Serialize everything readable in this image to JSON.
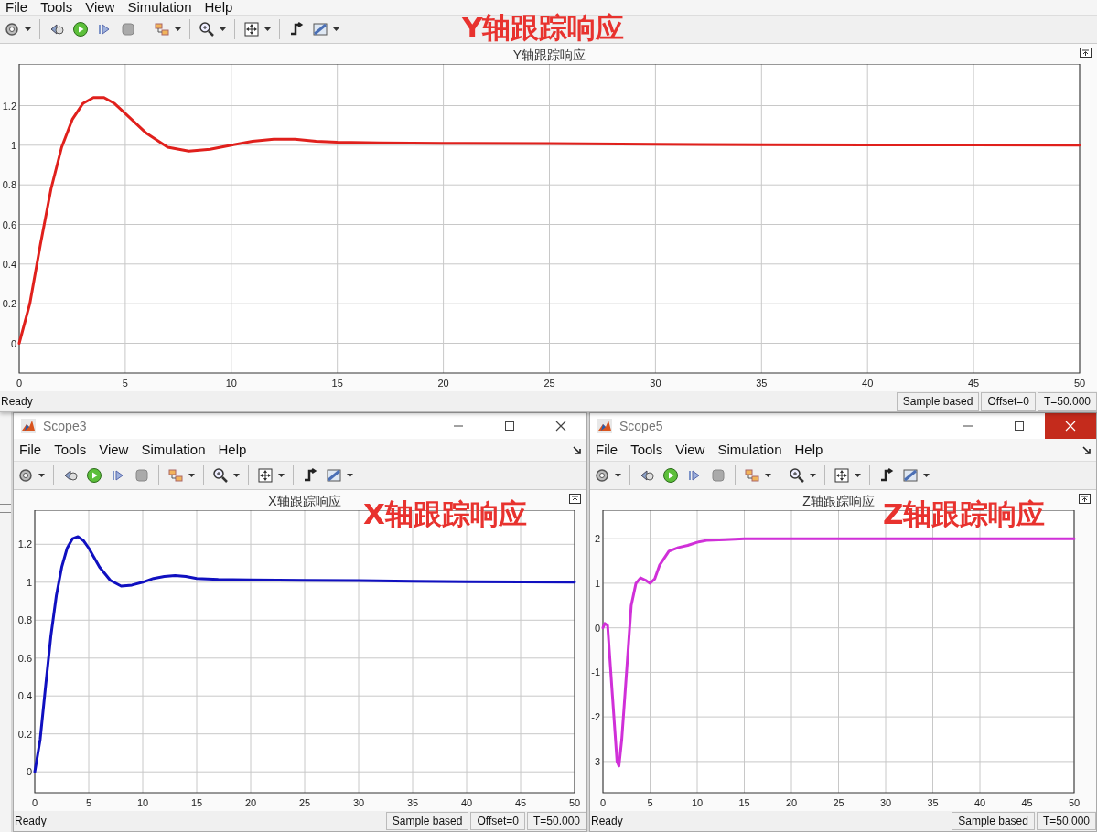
{
  "windows": [
    {
      "kind": "main",
      "menu": [
        "File",
        "Tools",
        "View",
        "Simulation",
        "Help"
      ],
      "annotation": "Y轴跟踪响应",
      "chart_data": {
        "type": "line",
        "title": "Y轴跟踪响应",
        "grid": true,
        "x": [
          0,
          0.5,
          1,
          1.5,
          2,
          2.5,
          3,
          3.5,
          4,
          4.5,
          5,
          6,
          7,
          8,
          9,
          10,
          11,
          12,
          13,
          14,
          15,
          17,
          20,
          25,
          30,
          35,
          40,
          45,
          50
        ],
        "xlim": [
          0,
          50
        ],
        "ylim": [
          -0.15,
          1.41
        ],
        "xticks": [
          0,
          5,
          10,
          15,
          20,
          25,
          30,
          35,
          40,
          45,
          50
        ],
        "yticks": [
          0,
          0.2,
          0.4,
          0.6,
          0.8,
          1,
          1.2
        ],
        "series": [
          {
            "color": "#e0201c",
            "values": [
              0,
              0.2,
              0.5,
              0.78,
              0.99,
              1.13,
              1.21,
              1.24,
              1.24,
              1.21,
              1.16,
              1.06,
              0.99,
              0.97,
              0.98,
              1.0,
              1.02,
              1.03,
              1.03,
              1.02,
              1.015,
              1.012,
              1.01,
              1.008,
              1.005,
              1.003,
              1.002,
              1.001,
              1.0
            ]
          }
        ]
      },
      "status_bar": {
        "message": "Ready",
        "fields": [
          "Sample based",
          "Offset=0",
          "T=50.000"
        ]
      }
    },
    {
      "kind": "scope",
      "title": "Scope3",
      "close_hover": false,
      "menu": [
        "File",
        "Tools",
        "View",
        "Simulation",
        "Help"
      ],
      "annotation": "X轴跟踪响应",
      "chart_data": {
        "type": "line",
        "title": "X轴跟踪响应",
        "grid": true,
        "x": [
          0,
          0.5,
          1,
          1.5,
          2,
          2.5,
          3,
          3.5,
          4,
          4.5,
          5,
          6,
          7,
          8,
          9,
          10,
          11,
          12,
          13,
          14,
          15,
          17,
          20,
          25,
          30,
          35,
          40,
          45,
          50
        ],
        "xlim": [
          0,
          50
        ],
        "ylim": [
          -0.11,
          1.38
        ],
        "xticks": [
          0,
          5,
          10,
          15,
          20,
          25,
          30,
          35,
          40,
          45,
          50
        ],
        "yticks": [
          0,
          0.2,
          0.4,
          0.6,
          0.8,
          1,
          1.2
        ],
        "series": [
          {
            "color": "#1010c0",
            "values": [
              0,
              0.17,
              0.45,
              0.72,
              0.93,
              1.08,
              1.18,
              1.23,
              1.24,
              1.22,
              1.18,
              1.08,
              1.01,
              0.98,
              0.985,
              1.0,
              1.02,
              1.03,
              1.035,
              1.03,
              1.02,
              1.015,
              1.012,
              1.01,
              1.008,
              1.005,
              1.003,
              1.002,
              1.0
            ]
          }
        ]
      },
      "status_bar": {
        "message": "Ready",
        "fields": [
          "Sample based",
          "Offset=0",
          "T=50.000"
        ]
      }
    },
    {
      "kind": "scope",
      "title": "Scope5",
      "close_hover": true,
      "menu": [
        "File",
        "Tools",
        "View",
        "Simulation",
        "Help"
      ],
      "annotation": "Z轴跟踪响应",
      "chart_data": {
        "type": "line",
        "title": "Z轴跟踪响应",
        "grid": true,
        "x": [
          0,
          0.2,
          0.5,
          1,
          1.5,
          1.7,
          2,
          2.5,
          3,
          3.5,
          4,
          4.5,
          5,
          5.5,
          6,
          7,
          8,
          9,
          10,
          11,
          13,
          15,
          20,
          25,
          30,
          35,
          40,
          45,
          50
        ],
        "xlim": [
          0,
          50
        ],
        "ylim": [
          -3.7,
          2.64
        ],
        "xticks": [
          0,
          5,
          10,
          15,
          20,
          25,
          30,
          35,
          40,
          45,
          50
        ],
        "yticks": [
          -3,
          -2,
          -1,
          0,
          1,
          2
        ],
        "series": [
          {
            "color": "#d030d8",
            "values": [
              0,
              0.1,
              0.05,
              -1.5,
              -3.0,
              -3.1,
              -2.5,
              -1.0,
              0.5,
              1.0,
              1.12,
              1.07,
              1.0,
              1.1,
              1.4,
              1.72,
              1.8,
              1.85,
              1.92,
              1.96,
              1.98,
              2.0,
              2.0,
              2.0,
              2.0,
              2.0,
              2.0,
              2.0,
              2.0
            ]
          }
        ]
      },
      "status_bar": {
        "message": "Ready",
        "fields": [
          "Sample based",
          "T=50.000"
        ]
      }
    }
  ]
}
